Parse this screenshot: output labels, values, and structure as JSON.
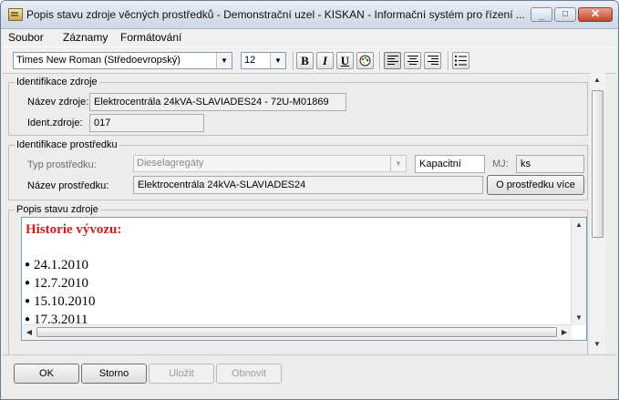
{
  "window": {
    "title": "Popis stavu zdroje věcných prostředků - Demonstrační uzel - KISKAN - Informační systém pro řízení ...",
    "buttons": {
      "minimize": "_",
      "maximize": "□",
      "close": "✕"
    }
  },
  "menu": {
    "items": [
      "Soubor",
      "Záznamy",
      "Formátování"
    ]
  },
  "toolbar": {
    "font_name": "Times New Roman (Středoevropský)",
    "font_size": "12",
    "bold": "B",
    "italic": "I",
    "underline": "U"
  },
  "identifikace_zdroje": {
    "legend": "Identifikace zdroje",
    "nazev_label": "Název zdroje:",
    "nazev_value": "Elektrocentrála 24kVA-SLAVIADES24 - 72U-M01869",
    "ident_label": "Ident.zdroje:",
    "ident_value": "017"
  },
  "identifikace_prostredku": {
    "legend": "Identifikace prostředku",
    "typ_label": "Typ prostředku:",
    "typ_value": "Dieselagregáty",
    "kapacitni": "Kapacitní",
    "mj_label": "MJ:",
    "mj_value": "ks",
    "nazev_label": "Název prostředku:",
    "nazev_value": "Elektrocentrála 24kVA-SLAVIADES24",
    "info_button": "O prostředku více"
  },
  "popis": {
    "legend": "Popis stavu zdroje",
    "heading": "Historie vývozu:",
    "heading_color": "#cc1f1f",
    "bullet": "●",
    "items": [
      "24.1.2010",
      "12.7.2010",
      "15.10.2010",
      "17.3.2011"
    ]
  },
  "buttons": {
    "ok": "OK",
    "storno": "Storno",
    "ulozit": "Uložit",
    "obnovit": "Obnovit"
  }
}
